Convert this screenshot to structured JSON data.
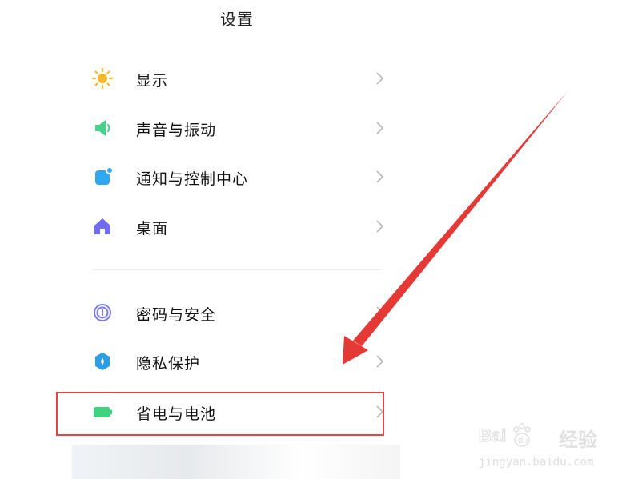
{
  "page": {
    "title": "设置"
  },
  "settings": {
    "items": [
      {
        "label": "显示",
        "icon": "sun-icon",
        "color": "#F7B928"
      },
      {
        "label": "声音与振动",
        "icon": "speaker-icon",
        "color": "#47D18A"
      },
      {
        "label": "通知与控制中心",
        "icon": "notification-icon",
        "color": "#2EA8F0"
      },
      {
        "label": "桌面",
        "icon": "home-icon",
        "color": "#6F6CF2"
      },
      {
        "label": "密码与安全",
        "icon": "fingerprint-icon",
        "color": "#7D7BF1"
      },
      {
        "label": "隐私保护",
        "icon": "privacy-shield-icon",
        "color": "#2A9DE8"
      },
      {
        "label": "省电与电池",
        "icon": "battery-icon",
        "color": "#3ED47F"
      }
    ]
  },
  "annotation": {
    "highlight_color": "#E24545",
    "arrow_color": "#E53935"
  },
  "watermark": {
    "brand": "经验",
    "url": "jingyan.baidu.com",
    "logo_text": "Bai du"
  }
}
